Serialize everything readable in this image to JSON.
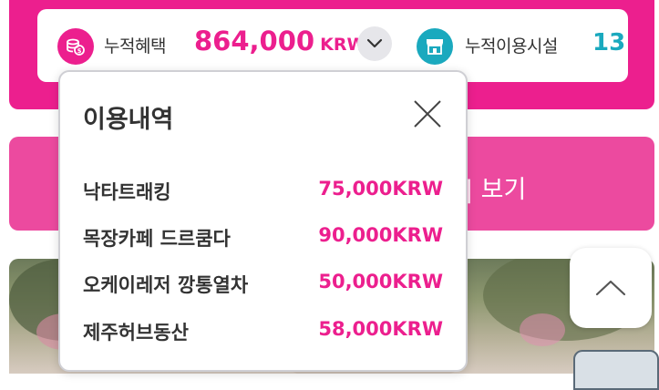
{
  "stats": {
    "benefit_label": "누적혜택",
    "benefit_value": "864,000",
    "benefit_unit": "KRW",
    "facility_label": "누적이용시설",
    "facility_count": "13"
  },
  "background_button": {
    "label_visible": "| 보기"
  },
  "usage_popup": {
    "title": "이용내역",
    "items": [
      {
        "name": "낙타트래킹",
        "amount": "75,000KRW"
      },
      {
        "name": "목장카페 드르쿰다",
        "amount": "90,000KRW"
      },
      {
        "name": "오케이레저 깡통열차",
        "amount": "50,000KRW"
      },
      {
        "name": "제주허브동산",
        "amount": "58,000KRW"
      }
    ]
  },
  "icons": {
    "coin": "coin-stack-icon",
    "store": "store-icon",
    "chevron": "chevron-down-icon",
    "close": "close-icon",
    "scroll_top": "chevron-up-icon"
  },
  "colors": {
    "brand_pink": "#ec1f8e",
    "button_pink": "#ec4a9f",
    "teal": "#1aa9be"
  }
}
